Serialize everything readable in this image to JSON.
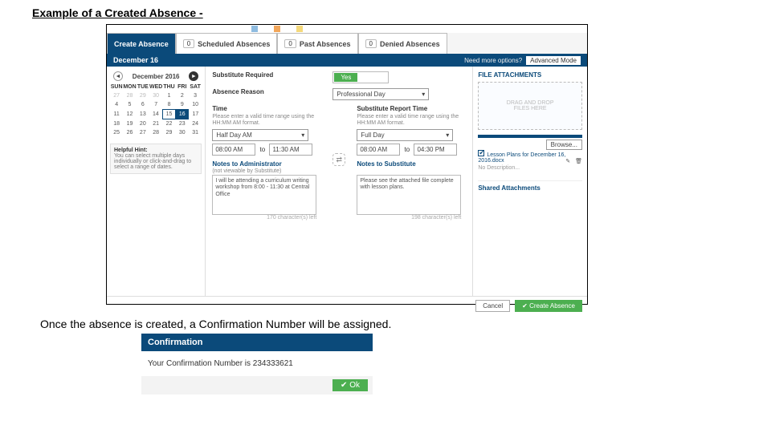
{
  "doc": {
    "heading": "Example of a Created Absence -",
    "caption": "Once the absence is created, a Confirmation Number will be assigned."
  },
  "tabs": {
    "create": "Create Absence",
    "sched": {
      "count": "0",
      "label": "Scheduled Absences"
    },
    "past": {
      "count": "0",
      "label": "Past Absences"
    },
    "denied": {
      "count": "0",
      "label": "Denied Absences"
    }
  },
  "datebar": {
    "date": "December 16",
    "more": "Need more options?",
    "adv": "Advanced Mode"
  },
  "calendar": {
    "month": "December 2016",
    "dows": [
      "SUN",
      "MON",
      "TUE",
      "WED",
      "THU",
      "FRI",
      "SAT"
    ],
    "rows": [
      [
        "27",
        "28",
        "29",
        "30",
        "1",
        "2",
        "3"
      ],
      [
        "4",
        "5",
        "6",
        "7",
        "8",
        "9",
        "10"
      ],
      [
        "11",
        "12",
        "13",
        "14",
        "15",
        "16",
        "17"
      ],
      [
        "18",
        "19",
        "20",
        "21",
        "22",
        "23",
        "24"
      ],
      [
        "25",
        "26",
        "27",
        "28",
        "29",
        "30",
        "31"
      ]
    ],
    "hint_title": "Helpful Hint:",
    "hint_body": "You can select multiple days individually or click-and-drag to select a range of dates."
  },
  "form": {
    "sub_req_label": "Substitute Required",
    "sub_req_value": "Yes",
    "reason_label": "Absence Reason",
    "reason_value": "Professional Day",
    "time_label": "Time",
    "time_hint": "Please enter a valid time range using the HH:MM AM format.",
    "time_select": "Half Day AM",
    "time_from": "08:00 AM",
    "time_to_lbl": "to",
    "time_to": "11:30 AM",
    "subrep_label": "Substitute Report Time",
    "subrep_hint": "Please enter a valid time range using the HH:MM AM format.",
    "subrep_select": "Full Day",
    "subrep_from": "08:00 AM",
    "subrep_to": "04:30 PM",
    "notes_admin_label": "Notes to Administrator",
    "notes_admin_sub": "(not viewable by Substitute)",
    "notes_admin_val": "I will be attending a curriculum writing workshop from 8:00 - 11:30 at Central Office",
    "notes_admin_left": "170 character(s) left",
    "notes_sub_label": "Notes to Substitute",
    "notes_sub_val": "Please see the attached file complete with lesson plans.",
    "notes_sub_left": "198 character(s) left"
  },
  "attach": {
    "heading": "FILE ATTACHMENTS",
    "drop1": "DRAG AND DROP",
    "drop2": "FILES HERE",
    "browse": "Browse...",
    "file_name": "Lesson Plans for December 16, 2016.docx",
    "no_desc": "No Description...",
    "shared": "Shared Attachments"
  },
  "footer": {
    "cancel": "Cancel",
    "create": "Create Absence"
  },
  "confirm": {
    "title": "Confirmation",
    "body": "Your Confirmation Number is 234333621",
    "ok": "Ok"
  }
}
